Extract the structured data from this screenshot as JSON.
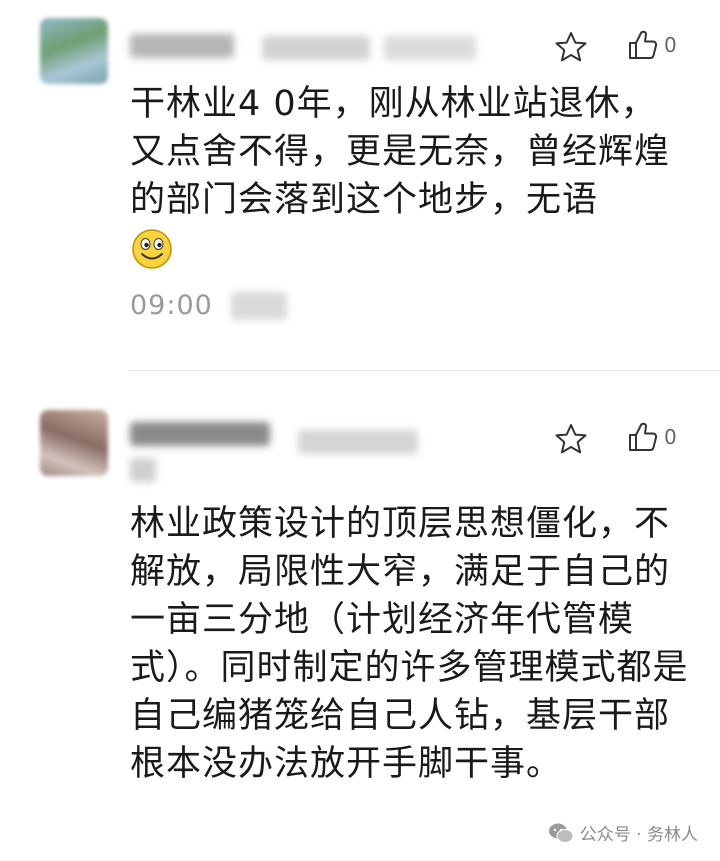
{
  "comments": [
    {
      "text": "干林业4 0年，刚从林业站退休，又点舍不得，更是无奈，曾经辉煌的部门会落到这个地步，无语",
      "like_count": "0",
      "time": "09:00"
    },
    {
      "text": "林业政策设计的顶层思想僵化，不解放，局限性大窄，满足于自己的一亩三分地（计划经济年代管模式）。同时制定的许多管理模式都是自己编猪笼给自己人钻，基层干部根本没办法放开手脚干事。",
      "like_count": "0"
    }
  ],
  "icons": {
    "avatar_1": "user-avatar",
    "star": "star-icon",
    "like": "thumbs-up-icon",
    "emoji": "smile-emoji-icon",
    "watermark": "wechat-icon"
  },
  "watermark": {
    "text": "公众号 · 务林人"
  }
}
